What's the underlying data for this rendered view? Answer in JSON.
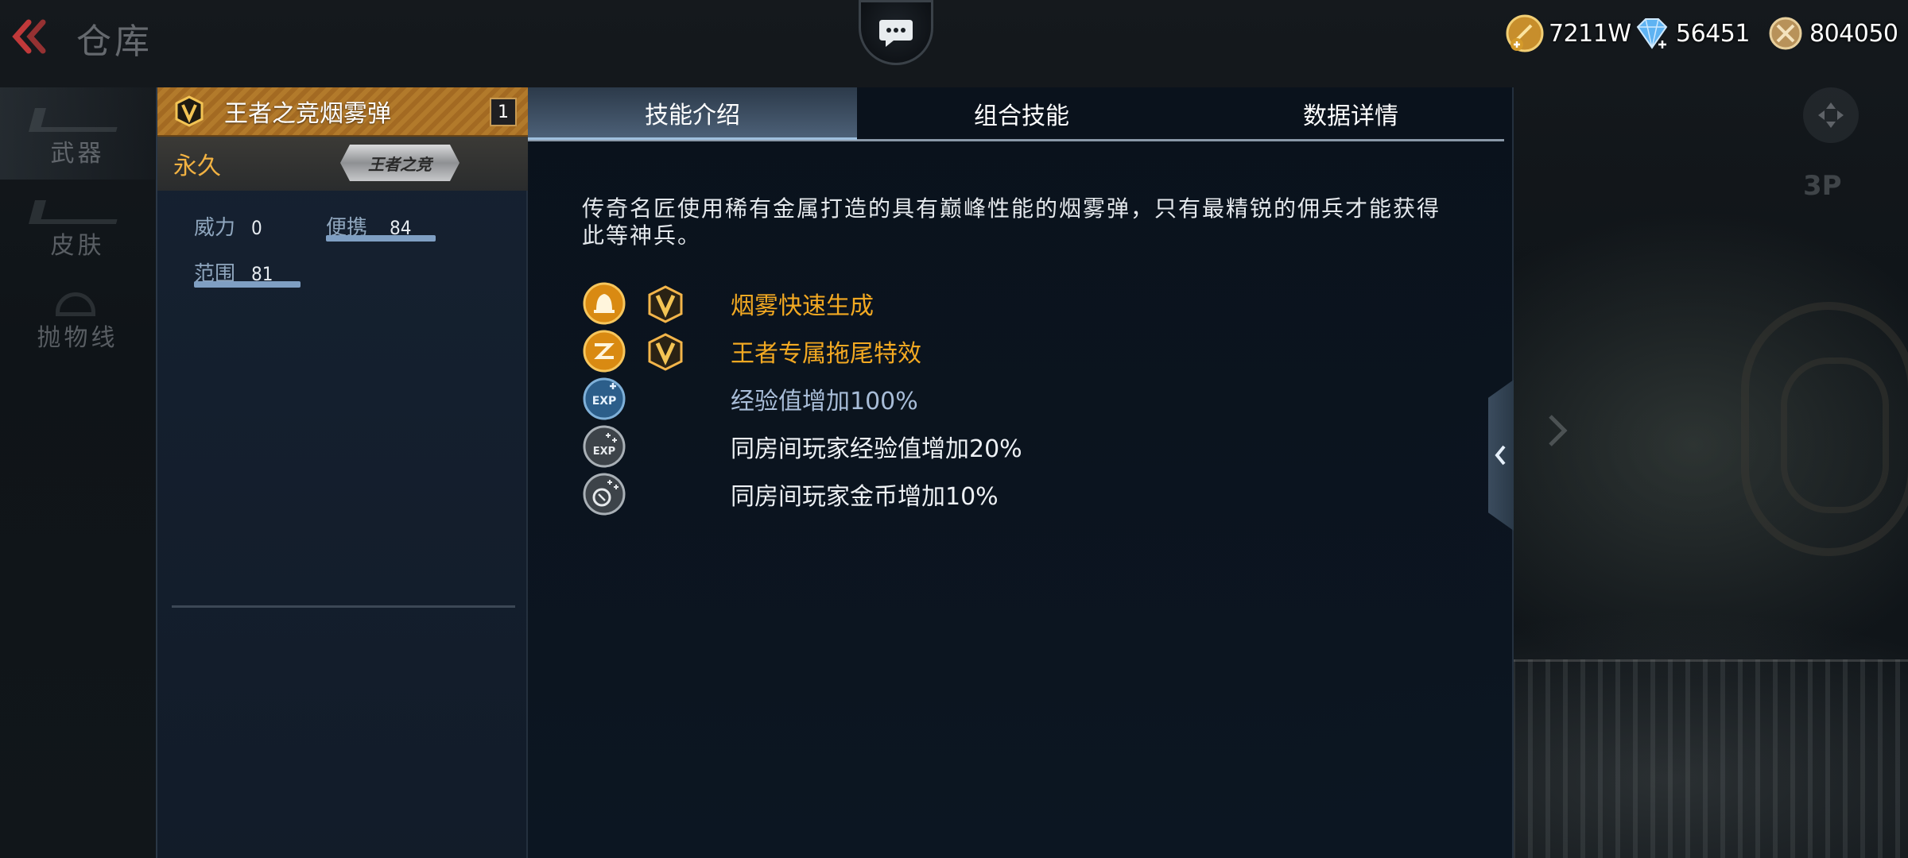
{
  "page": {
    "title": "仓库"
  },
  "currencies": [
    {
      "name": "gold-coin",
      "value": "7211W",
      "color": "#d7a43b"
    },
    {
      "name": "diamond",
      "value": "56451",
      "color": "#7ec3ff"
    },
    {
      "name": "medal",
      "value": "804050",
      "color": "#d8b57a"
    }
  ],
  "sidenav": {
    "items": [
      {
        "label": "武器"
      },
      {
        "label": "皮肤"
      },
      {
        "label": "抛物线"
      }
    ]
  },
  "rightnav": {
    "view_label": "3P"
  },
  "item": {
    "name": "王者之竞烟雾弹",
    "count": "1",
    "duration": "永久",
    "badge": "王者之竞",
    "stats": [
      {
        "label": "威力",
        "value": "0",
        "level": 0
      },
      {
        "label": "便携",
        "value": "84",
        "level": 0.84
      },
      {
        "label": "范围",
        "value": "81",
        "level": 0.81
      }
    ]
  },
  "tabs": [
    {
      "label": "技能介绍"
    },
    {
      "label": "组合技能"
    },
    {
      "label": "数据详情"
    }
  ],
  "description": "传奇名匠使用稀有金属打造的具有巅峰性能的烟雾弹，只有最精锐的佣兵才能获得此等神兵。",
  "skills": [
    {
      "icon": "smoke-bell-icon",
      "text": "烟雾快速生成",
      "style": "gold",
      "king": true
    },
    {
      "icon": "trail-effect-icon",
      "text": "王者专属拖尾特效",
      "style": "gold",
      "king": true
    },
    {
      "icon": "exp-plus-icon",
      "text": "经验值增加100%",
      "style": "blue",
      "king": false
    },
    {
      "icon": "room-exp-icon",
      "text": "同房间玩家经验值增加20%",
      "style": "white",
      "king": false
    },
    {
      "icon": "room-coin-icon",
      "text": "同房间玩家金币增加10%",
      "style": "white",
      "king": false
    }
  ],
  "colors": {
    "accent_gold": "#f3a922",
    "panel_bg": "#0c1622",
    "tab_active": "#4c6077"
  }
}
